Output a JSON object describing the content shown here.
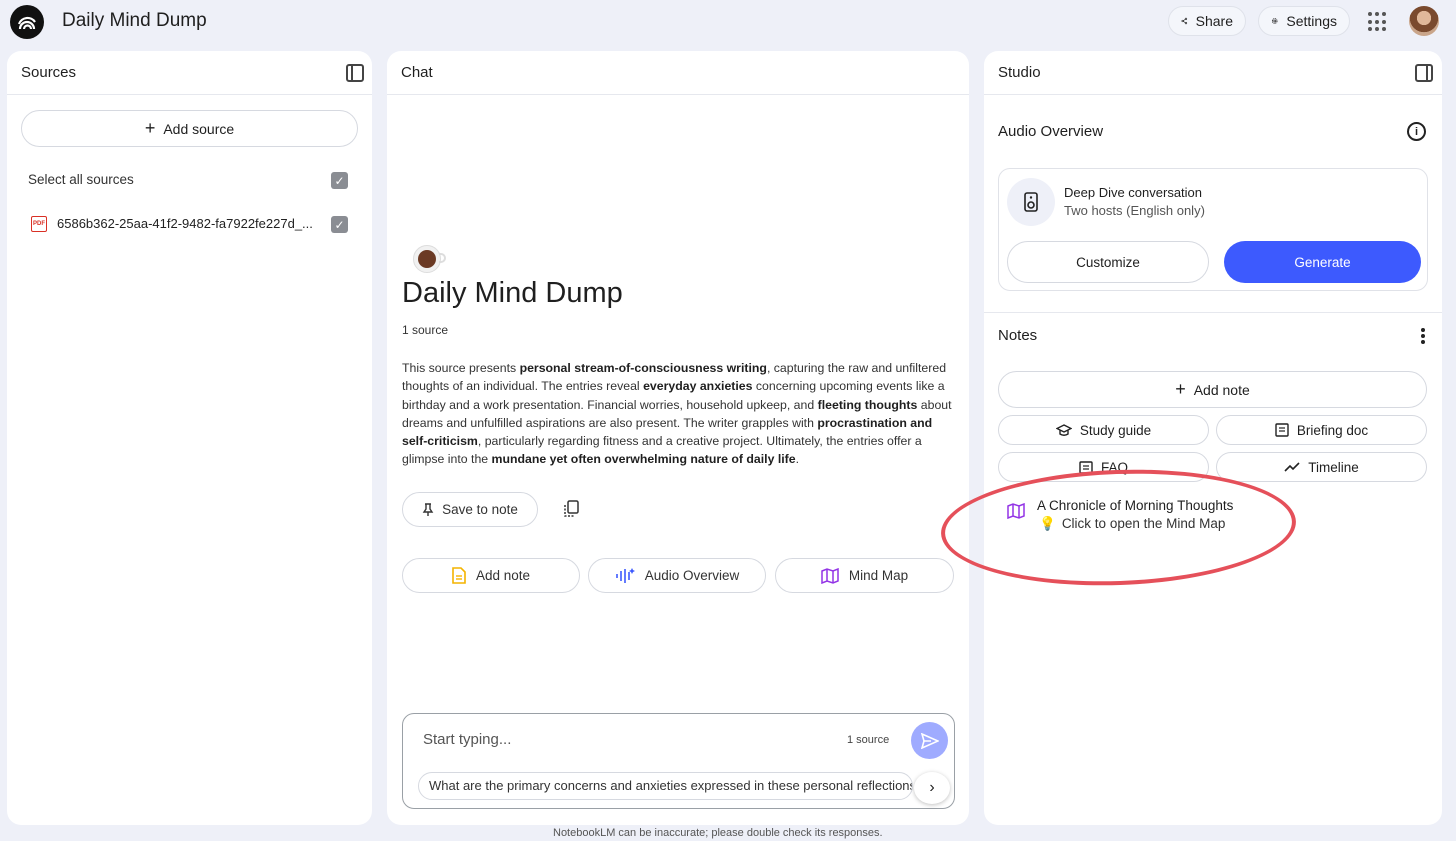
{
  "app": {
    "title": "Daily Mind Dump"
  },
  "header": {
    "share_label": "Share",
    "settings_label": "Settings",
    "icons": {
      "logo": "notebooklm-logo-icon",
      "share": "share-icon",
      "settings": "gear-icon",
      "apps": "apps-grid-icon",
      "avatar": "avatar"
    }
  },
  "sources": {
    "title": "Sources",
    "add_source_label": "Add source",
    "select_all_label": "Select all sources",
    "select_all_checked": true,
    "items": [
      {
        "name": "6586b362-25aa-41f2-9482-fa7922fe227d_...",
        "type": "PDF",
        "checked": true
      }
    ]
  },
  "chat": {
    "title": "Chat",
    "notebook_title": "Daily Mind Dump",
    "source_count": "1 source",
    "summary_parts": [
      {
        "text": "This source presents ",
        "bold": false
      },
      {
        "text": "personal stream-of-consciousness writing",
        "bold": true
      },
      {
        "text": ", capturing the raw and unfiltered thoughts of an individual. The entries reveal ",
        "bold": false
      },
      {
        "text": "everyday anxieties",
        "bold": true
      },
      {
        "text": " concerning upcoming events like a birthday and a work presentation. Financial worries, household upkeep, and ",
        "bold": false
      },
      {
        "text": "fleeting thoughts",
        "bold": true
      },
      {
        "text": " about dreams and unfulfilled aspirations are also present. The writer grapples with ",
        "bold": false
      },
      {
        "text": "procrastination and self-criticism",
        "bold": true
      },
      {
        "text": ", particularly regarding fitness and a creative project. Ultimately, the entries offer a glimpse into the ",
        "bold": false
      },
      {
        "text": "mundane yet often overwhelming nature of daily life",
        "bold": true
      },
      {
        "text": ".",
        "bold": false
      }
    ],
    "save_to_note_label": "Save to note",
    "chips": {
      "add_note": "Add note",
      "audio_overview": "Audio Overview",
      "mind_map": "Mind Map"
    },
    "input_placeholder": "Start typing...",
    "input_source_count": "1 source",
    "suggestion": "What are the primary concerns and anxieties expressed in these personal reflections?",
    "disclaimer": "NotebookLM can be inaccurate; please double check its responses."
  },
  "studio": {
    "title": "Studio",
    "audio_overview_title": "Audio Overview",
    "audio_card": {
      "title": "Deep Dive conversation",
      "subtitle": "Two hosts (English only)",
      "customize_label": "Customize",
      "generate_label": "Generate"
    },
    "notes_title": "Notes",
    "add_note_label": "Add note",
    "note_chips": {
      "study_guide": "Study guide",
      "briefing_doc": "Briefing doc",
      "faq": "FAQ",
      "timeline": "Timeline"
    },
    "mind_map_note": {
      "title": "A Chronicle of Morning Thoughts",
      "subtitle": "Click to open the Mind Map"
    }
  },
  "colors": {
    "background": "#eef0f8",
    "primary_button": "#3d5afe",
    "send_button": "#9fabff",
    "annotation_circle": "#e5505a",
    "mind_map_icon": "#9334e6"
  }
}
